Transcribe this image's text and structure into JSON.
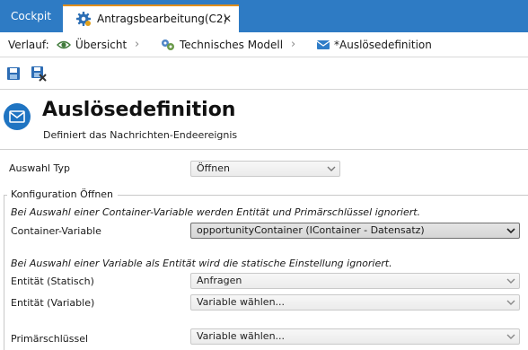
{
  "tabs": [
    {
      "label": "Cockpit",
      "active": false
    },
    {
      "label": "Antragsbearbeitung(C2)",
      "active": true,
      "icon": "gear-icon",
      "close": "✕"
    }
  ],
  "breadcrumb": {
    "prefix": "Verlauf:",
    "items": [
      {
        "label": "Übersicht",
        "icon": "eye-icon"
      },
      {
        "label": "Technisches Modell",
        "icon": "gears-icon"
      },
      {
        "label": "*Auslösedefinition",
        "icon": "envelope-icon"
      }
    ],
    "separator": "›"
  },
  "toolbar": {
    "buttons": [
      "save-icon",
      "save-close-icon"
    ]
  },
  "header": {
    "title": "Auslösedefinition",
    "subtitle": "Definiert das Nachrichten-Endeereignis",
    "icon": "envelope-icon"
  },
  "form": {
    "auswahl_typ_label": "Auswahl Typ",
    "auswahl_typ_value": "Öffnen",
    "group_title": "Konfiguration Öffnen",
    "hint_container": "Bei Auswahl einer Container-Variable werden Entität und Primärschlüssel ignoriert.",
    "container_label": "Container-Variable",
    "container_value": "opportunityContainer (IContainer - Datensatz)",
    "hint_variable": "Bei Auswahl einer Variable als Entität wird die statische Einstellung ignoriert.",
    "entitaet_statisch_label": "Entität (Statisch)",
    "entitaet_statisch_value": "Anfragen",
    "entitaet_variable_label": "Entität (Variable)",
    "entitaet_variable_value": "Variable wählen...",
    "primaer_label": "Primärschlüssel",
    "primaer_value": "Variable wählen..."
  },
  "colors": {
    "tabbar": "#2e7bc4",
    "active_tab_accent": "#e08e1c",
    "icon_blue": "#1f74c2"
  }
}
